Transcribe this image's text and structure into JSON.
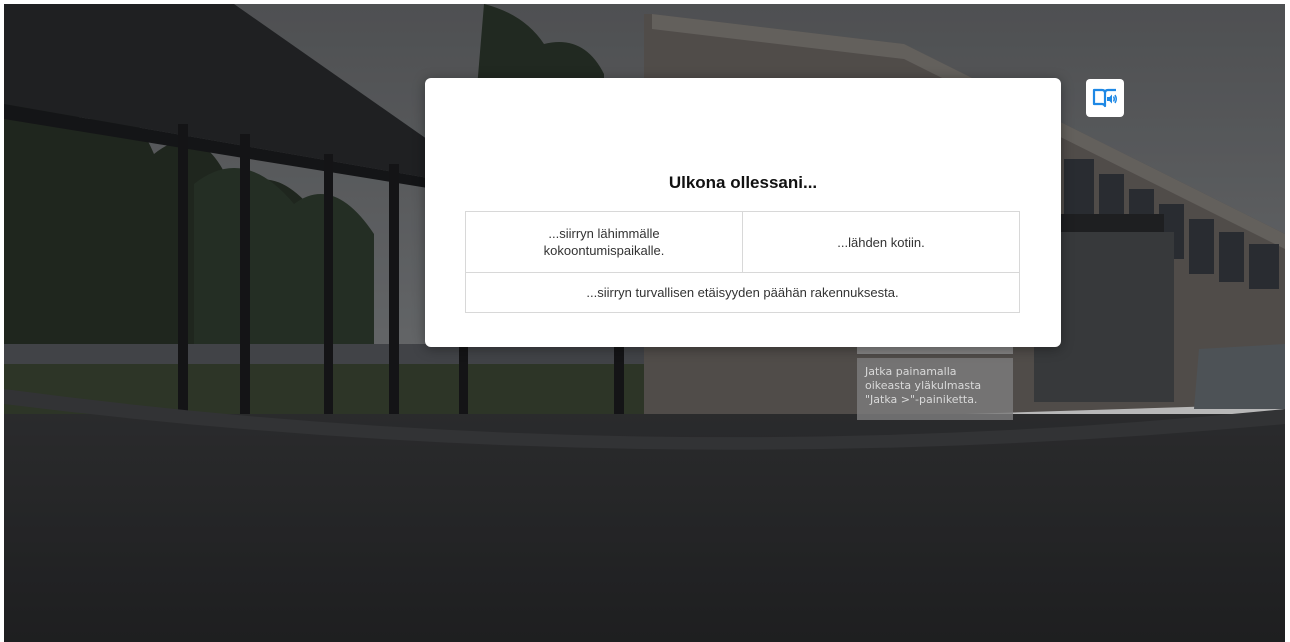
{
  "dialog": {
    "title": "Ulkona ollessani...",
    "options": [
      "...siirryn lähimmälle kokoontumispaikalle.",
      "...lähden kotiin.",
      "...siirryn turvallisen etäisyyden päähän rakennuksesta."
    ]
  },
  "hint": {
    "text": "Jatka painamalla oikeasta yläkulmasta \"Jatka >\"-painiketta."
  },
  "audio_button": {
    "icon": "audio-book-icon",
    "color": "#1e88e5"
  }
}
